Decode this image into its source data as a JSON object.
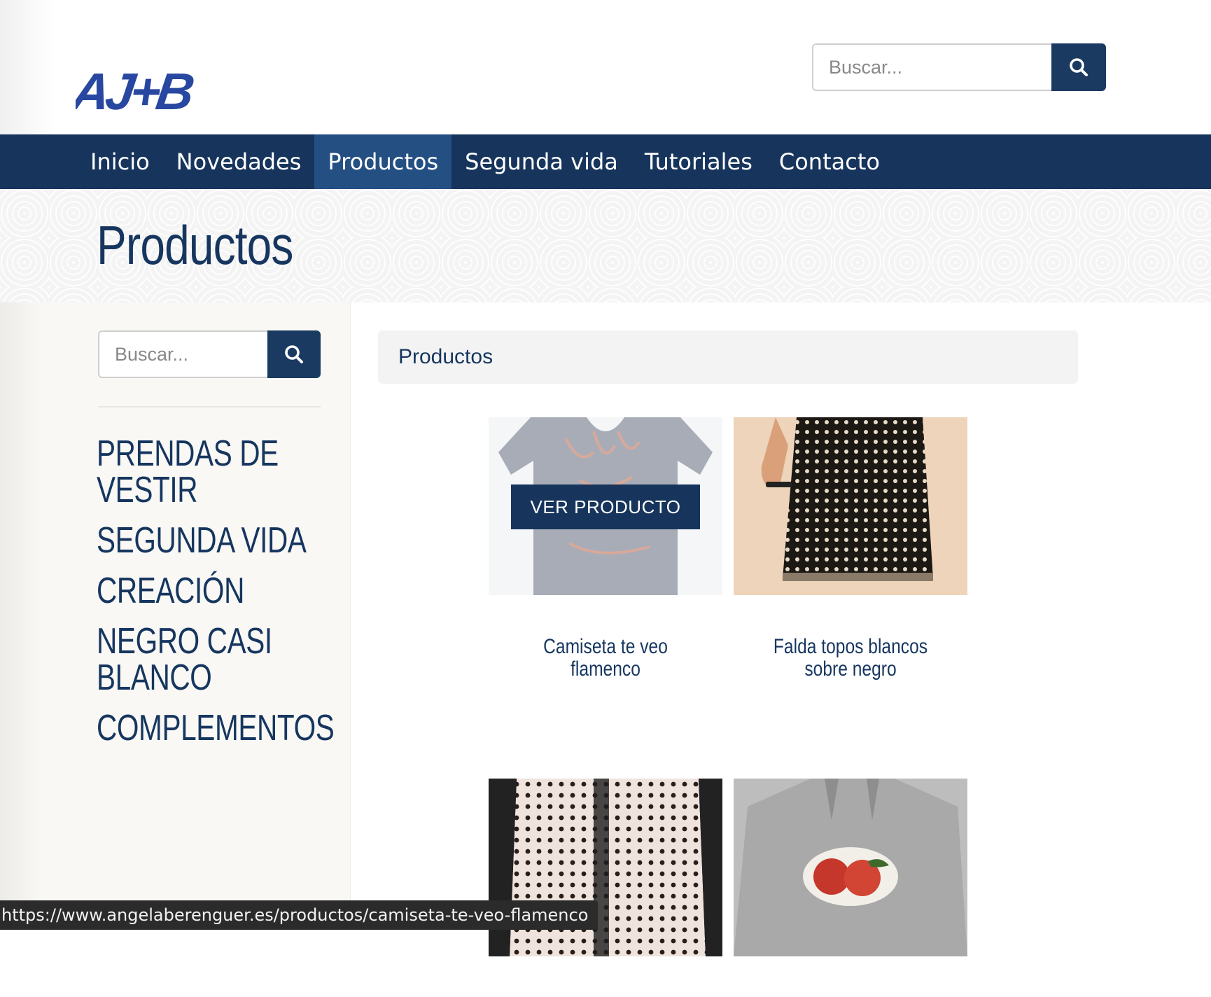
{
  "header": {
    "logo_text": "AJ+B",
    "search": {
      "placeholder": "Buscar..."
    }
  },
  "nav": {
    "items": [
      {
        "label": "Inicio"
      },
      {
        "label": "Novedades"
      },
      {
        "label": "Productos"
      },
      {
        "label": "Segunda vida"
      },
      {
        "label": "Tutoriales"
      },
      {
        "label": "Contacto"
      }
    ]
  },
  "page": {
    "title": "Productos"
  },
  "sidebar": {
    "search": {
      "placeholder": "Buscar..."
    },
    "categories": [
      {
        "label": "PRENDAS DE VESTIR"
      },
      {
        "label": "SEGUNDA VIDA"
      },
      {
        "label": "CREACIÓN"
      },
      {
        "label": "NEGRO CASI BLANCO"
      },
      {
        "label": "COMPLEMENTOS"
      }
    ]
  },
  "main": {
    "breadcrumb": "Productos",
    "products": [
      {
        "name": "Camiseta te veo flamenco",
        "hover_button": "VER PRODUCTO"
      },
      {
        "name": "Falda topos blancos sobre negro"
      },
      {
        "name": ""
      },
      {
        "name": ""
      }
    ]
  },
  "status_bar": {
    "url": "https://www.angelaberenguer.es/productos/camiseta-te-veo-flamenco"
  },
  "colors": {
    "navy": "#17355c",
    "active_nav": "#244f82",
    "text": "#16365f"
  }
}
